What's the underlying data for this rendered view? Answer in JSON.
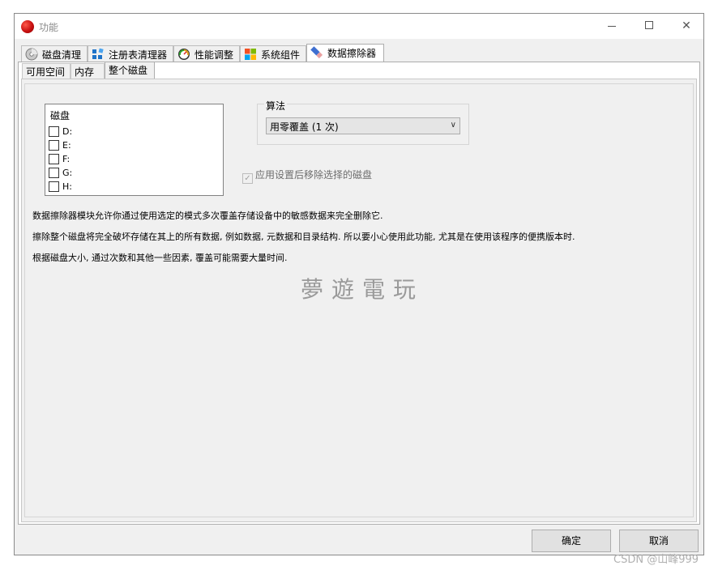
{
  "window": {
    "title": "功能"
  },
  "tabs": [
    {
      "label": "磁盘清理",
      "icon": "disk-cleaner-icon"
    },
    {
      "label": "注册表清理器",
      "icon": "registry-icon"
    },
    {
      "label": "性能调整",
      "icon": "gauge-icon"
    },
    {
      "label": "系统组件",
      "icon": "windows-logo-icon"
    },
    {
      "label": "数据擦除器",
      "icon": "eraser-icon",
      "active": true
    }
  ],
  "subtabs": [
    {
      "label": "可用空间"
    },
    {
      "label": "内存"
    },
    {
      "label": "整个磁盘",
      "active": true
    }
  ],
  "disks": {
    "title": "磁盘",
    "items": [
      "D:",
      "E:",
      "F:",
      "G:",
      "H:"
    ]
  },
  "algorithm": {
    "label": "算法",
    "selected": "用零覆盖 (1 次)"
  },
  "apply_option": {
    "label": "应用设置后移除选择的磁盘",
    "checked": true,
    "disabled": true
  },
  "description": [
    "数据擦除器模块允许你通过使用选定的模式多次覆盖存储设备中的敏感数据来完全删除它.",
    "擦除整个磁盘将完全破坏存储在其上的所有数据, 例如数据, 元数据和目录结构. 所以要小心使用此功能, 尤其是在使用该程序的便携版本时.",
    "根据磁盘大小, 通过次数和其他一些因素, 覆盖可能需要大量时间."
  ],
  "watermark": "夢遊電玩",
  "buttons": {
    "ok": "确定",
    "cancel": "取消"
  },
  "corner_watermark": "CSDN @山峰999"
}
